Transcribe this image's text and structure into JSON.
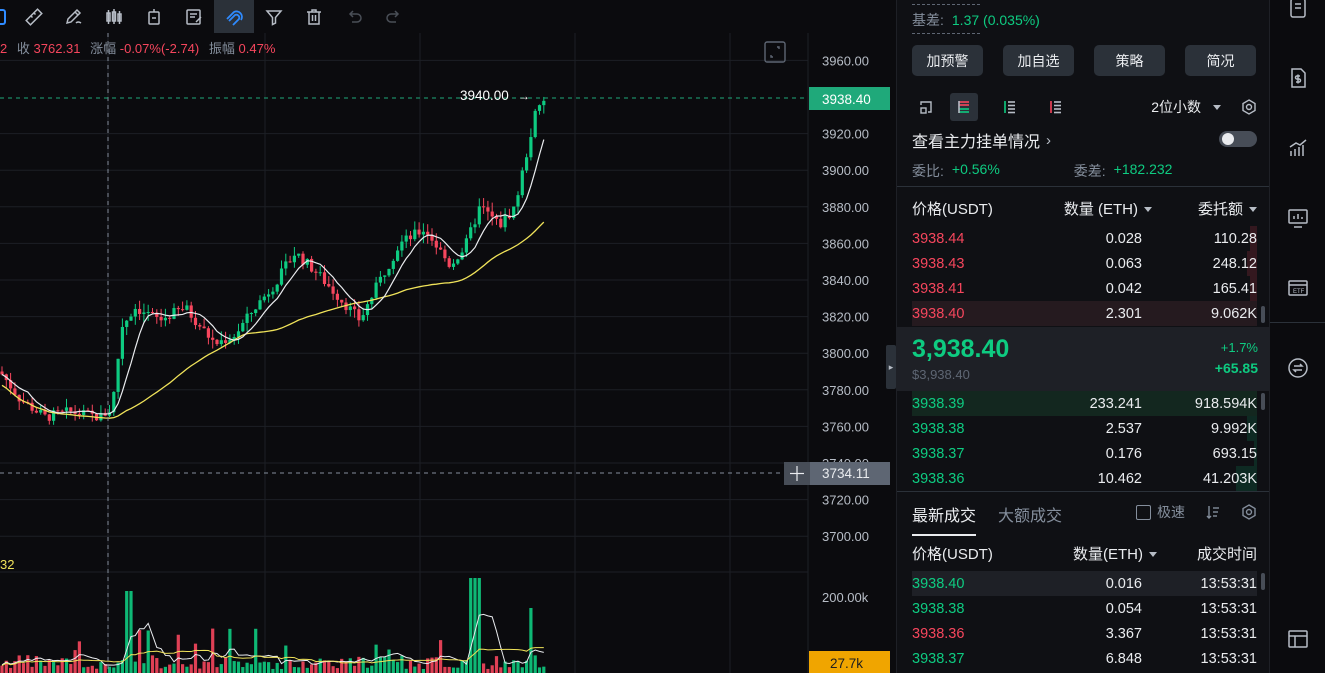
{
  "ohlc": {
    "close_prefix": "2",
    "close_label": "收",
    "close_value": "3762.31",
    "change_label": "涨幅",
    "change_value": "-0.07%(-2.74)",
    "amplitude_label": "振幅",
    "amplitude_value": "0.47%"
  },
  "chart": {
    "price_axis": [
      "3960.00",
      "3920.00",
      "3900.00",
      "3880.00",
      "3860.00",
      "3840.00",
      "3820.00",
      "3800.00",
      "3780.00",
      "3760.00",
      "3740.00",
      "3720.00",
      "3700.00"
    ],
    "current_price_tag": "3938.40",
    "cursor_price_tag": "3734.11",
    "high_marker": "3940.00",
    "volume_axis": [
      "200.00k"
    ],
    "volume_tag": "27.7k",
    "volume_ma_label": "32",
    "colors": {
      "up": "#0ecb81",
      "down": "#f6465d",
      "ma_fast": "#eaecef",
      "ma_slow": "#f0e35a",
      "price_tag_bg": "#1fa97a",
      "volume_tag_bg": "#f0a500"
    }
  },
  "toolbar": {
    "icons": [
      "ruler-icon",
      "pen-icon",
      "candles-icon",
      "position-icon",
      "note-icon",
      "magnet-icon",
      "filter-icon",
      "trash-icon",
      "undo-icon",
      "redo-icon"
    ]
  },
  "panel": {
    "basis_label": "基差:",
    "basis_value": "1.37 (0.035%)",
    "buttons": [
      "加预警",
      "加自选",
      "策略",
      "简况"
    ],
    "decimals": "2位小数",
    "whale_label": "查看主力挂单情况",
    "ratio_label": "委比:",
    "ratio_value": "+0.56%",
    "diff_label": "委差:",
    "diff_value": "+182.232"
  },
  "orderbook": {
    "headers": {
      "price": "价格(USDT)",
      "qty": "数量 (ETH)",
      "total": "委托额"
    },
    "asks": [
      {
        "price": "3938.44",
        "qty": "0.028",
        "total": "110.28"
      },
      {
        "price": "3938.43",
        "qty": "0.063",
        "total": "248.12"
      },
      {
        "price": "3938.41",
        "qty": "0.042",
        "total": "165.41"
      },
      {
        "price": "3938.40",
        "qty": "2.301",
        "total": "9.062K"
      }
    ],
    "last_price": "3,938.40",
    "last_price_usd": "$3,938.40",
    "change_pct": "+1.7%",
    "change_abs": "+65.85",
    "bids": [
      {
        "price": "3938.39",
        "qty": "233.241",
        "total": "918.594K"
      },
      {
        "price": "3938.38",
        "qty": "2.537",
        "total": "9.992K"
      },
      {
        "price": "3938.37",
        "qty": "0.176",
        "total": "693.15"
      },
      {
        "price": "3938.36",
        "qty": "10.462",
        "total": "41.203K"
      }
    ]
  },
  "trades": {
    "tab_latest": "最新成交",
    "tab_large": "大额成交",
    "fast_label": "极速",
    "headers": {
      "price": "价格(USDT)",
      "qty": "数量(ETH)",
      "time": "成交时间"
    },
    "rows": [
      {
        "price": "3938.40",
        "qty": "0.016",
        "time": "13:53:31",
        "side": "buy"
      },
      {
        "price": "3938.38",
        "qty": "0.054",
        "time": "13:53:31",
        "side": "buy"
      },
      {
        "price": "3938.36",
        "qty": "3.367",
        "time": "13:53:31",
        "side": "sell"
      },
      {
        "price": "3938.37",
        "qty": "6.848",
        "time": "13:53:31",
        "side": "buy"
      }
    ]
  }
}
